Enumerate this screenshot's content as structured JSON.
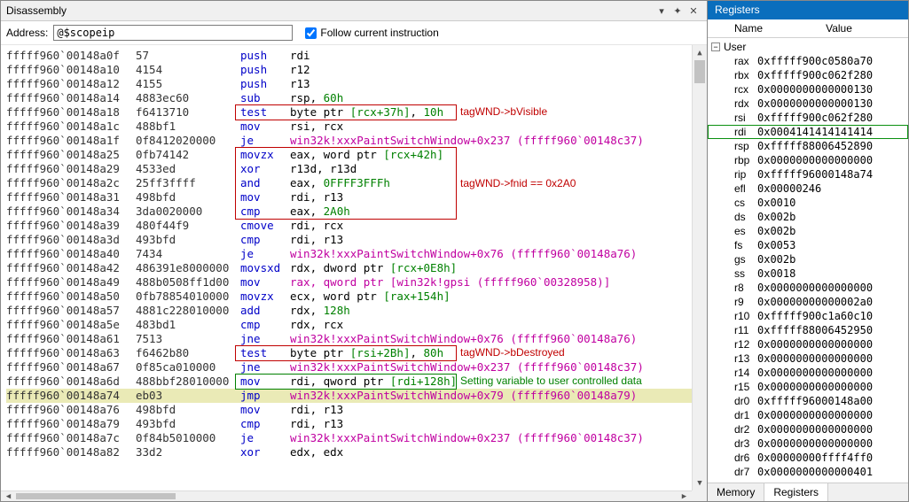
{
  "disasm": {
    "title": "Disassembly",
    "address_label": "Address:",
    "address_value": "@$scopeip",
    "follow_label": "Follow current instruction",
    "follow_checked": true,
    "rows": [
      {
        "addr": "fffff960`00148a0f",
        "bytes": "57",
        "mnem": "push",
        "ops": "rdi"
      },
      {
        "addr": "fffff960`00148a10",
        "bytes": "4154",
        "mnem": "push",
        "ops": "r12"
      },
      {
        "addr": "fffff960`00148a12",
        "bytes": "4155",
        "mnem": "push",
        "ops": "r13"
      },
      {
        "addr": "fffff960`00148a14",
        "bytes": "4883ec60",
        "mnem": "sub",
        "ops": "rsp, <num>60h</num>"
      },
      {
        "addr": "fffff960`00148a18",
        "bytes": "f6413710",
        "mnem": "test",
        "ops": "byte ptr <exp>[rcx+37h]</exp>, <num>10h</num>"
      },
      {
        "addr": "fffff960`00148a1c",
        "bytes": "488bf1",
        "mnem": "mov",
        "ops": "rsi, rcx"
      },
      {
        "addr": "fffff960`00148a1f",
        "bytes": "0f8412020000",
        "mnem": "je",
        "ops": "win32k!xxxPaintSwitchWindow+0x237 (fffff960`00148c37)",
        "call": true
      },
      {
        "addr": "fffff960`00148a25",
        "bytes": "0fb74142",
        "mnem": "movzx",
        "ops": "eax, word ptr <exp>[rcx+42h]</exp>"
      },
      {
        "addr": "fffff960`00148a29",
        "bytes": "4533ed",
        "mnem": "xor",
        "ops": "r13d, r13d"
      },
      {
        "addr": "fffff960`00148a2c",
        "bytes": "25ff3ffff",
        "mnem": "and",
        "ops": "eax, <num>0FFFF3FFFh</num>"
      },
      {
        "addr": "fffff960`00148a31",
        "bytes": "498bfd",
        "mnem": "mov",
        "ops": "rdi, r13"
      },
      {
        "addr": "fffff960`00148a34",
        "bytes": "3da0020000",
        "mnem": "cmp",
        "ops": "eax, <num>2A0h</num>"
      },
      {
        "addr": "fffff960`00148a39",
        "bytes": "480f44f9",
        "mnem": "cmove",
        "ops": "rdi, rcx"
      },
      {
        "addr": "fffff960`00148a3d",
        "bytes": "493bfd",
        "mnem": "cmp",
        "ops": "rdi, r13"
      },
      {
        "addr": "fffff960`00148a40",
        "bytes": "7434",
        "mnem": "je",
        "ops": "win32k!xxxPaintSwitchWindow+0x76 (fffff960`00148a76)",
        "call": true
      },
      {
        "addr": "fffff960`00148a42",
        "bytes": "486391e8000000",
        "mnem": "movsxd",
        "ops": "rdx, dword ptr <exp>[rcx+0E8h]</exp>"
      },
      {
        "addr": "fffff960`00148a49",
        "bytes": "488b0508ff1d00",
        "mnem": "mov",
        "ops": "rax, qword ptr [win32k!gpsi (fffff960`00328958)]",
        "call": true
      },
      {
        "addr": "fffff960`00148a50",
        "bytes": "0fb78854010000",
        "mnem": "movzx",
        "ops": "ecx, word ptr <exp>[rax+154h]</exp>"
      },
      {
        "addr": "fffff960`00148a57",
        "bytes": "4881c228010000",
        "mnem": "add",
        "ops": "rdx, <num>128h</num>"
      },
      {
        "addr": "fffff960`00148a5e",
        "bytes": "483bd1",
        "mnem": "cmp",
        "ops": "rdx, rcx"
      },
      {
        "addr": "fffff960`00148a61",
        "bytes": "7513",
        "mnem": "jne",
        "ops": "win32k!xxxPaintSwitchWindow+0x76 (fffff960`00148a76)",
        "call": true
      },
      {
        "addr": "fffff960`00148a63",
        "bytes": "f6462b80",
        "mnem": "test",
        "ops": "byte ptr <exp>[rsi+2Bh]</exp>, <num>80h</num>"
      },
      {
        "addr": "fffff960`00148a67",
        "bytes": "0f85ca010000",
        "mnem": "jne",
        "ops": "win32k!xxxPaintSwitchWindow+0x237 (fffff960`00148c37)",
        "call": true
      },
      {
        "addr": "fffff960`00148a6d",
        "bytes": "488bbf28010000",
        "mnem": "mov",
        "ops": "rdi, qword ptr <exp>[rdi+128h]</exp>"
      },
      {
        "addr": "fffff960`00148a74",
        "bytes": "eb03",
        "mnem": "jmp",
        "ops": "win32k!xxxPaintSwitchWindow+0x79 (fffff960`00148a79)",
        "call": true,
        "current": true
      },
      {
        "addr": "fffff960`00148a76",
        "bytes": "498bfd",
        "mnem": "mov",
        "ops": "rdi, r13"
      },
      {
        "addr": "fffff960`00148a79",
        "bytes": "493bfd",
        "mnem": "cmp",
        "ops": "rdi, r13"
      },
      {
        "addr": "fffff960`00148a7c",
        "bytes": "0f84b5010000",
        "mnem": "je",
        "ops": "win32k!xxxPaintSwitchWindow+0x237 (fffff960`00148c37)",
        "call": true
      },
      {
        "addr": "fffff960`00148a82",
        "bytes": "33d2",
        "mnem": "xor",
        "ops": "edx, edx"
      }
    ],
    "annotations": {
      "box1": {
        "top_row": 4,
        "rows": 1,
        "text": "tagWND->bVisible"
      },
      "box2": {
        "top_row": 7,
        "rows": 5,
        "text": "tagWND->fnid == 0x2A0"
      },
      "box3": {
        "top_row": 21,
        "rows": 1,
        "text": "tagWND->bDestroyed"
      },
      "gbox": {
        "top_row": 23,
        "rows": 1,
        "text": "Setting variable to user controlled data"
      }
    }
  },
  "registers": {
    "title": "Registers",
    "name_header": "Name",
    "value_header": "Value",
    "group": "User",
    "highlight": "rdi",
    "rows": [
      {
        "name": "rax",
        "val": "0xfffff900c0580a70"
      },
      {
        "name": "rbx",
        "val": "0xfffff900c062f280"
      },
      {
        "name": "rcx",
        "val": "0x0000000000000130"
      },
      {
        "name": "rdx",
        "val": "0x0000000000000130"
      },
      {
        "name": "rsi",
        "val": "0xfffff900c062f280"
      },
      {
        "name": "rdi",
        "val": "0x0004141414141414"
      },
      {
        "name": "rsp",
        "val": "0xfffff88006452890"
      },
      {
        "name": "rbp",
        "val": "0x0000000000000000"
      },
      {
        "name": "rip",
        "val": "0xfffff96000148a74"
      },
      {
        "name": "efl",
        "val": "0x00000246"
      },
      {
        "name": "cs",
        "val": "0x0010"
      },
      {
        "name": "ds",
        "val": "0x002b"
      },
      {
        "name": "es",
        "val": "0x002b"
      },
      {
        "name": "fs",
        "val": "0x0053"
      },
      {
        "name": "gs",
        "val": "0x002b"
      },
      {
        "name": "ss",
        "val": "0x0018"
      },
      {
        "name": "r8",
        "val": "0x0000000000000000"
      },
      {
        "name": "r9",
        "val": "0x00000000000002a0"
      },
      {
        "name": "r10",
        "val": "0xfffff900c1a60c10"
      },
      {
        "name": "r11",
        "val": "0xfffff88006452950"
      },
      {
        "name": "r12",
        "val": "0x0000000000000000"
      },
      {
        "name": "r13",
        "val": "0x0000000000000000"
      },
      {
        "name": "r14",
        "val": "0x0000000000000000"
      },
      {
        "name": "r15",
        "val": "0x0000000000000000"
      },
      {
        "name": "dr0",
        "val": "0xfffff96000148a00"
      },
      {
        "name": "dr1",
        "val": "0x0000000000000000"
      },
      {
        "name": "dr2",
        "val": "0x0000000000000000"
      },
      {
        "name": "dr3",
        "val": "0x0000000000000000"
      },
      {
        "name": "dr6",
        "val": "0x00000000ffff4ff0"
      },
      {
        "name": "dr7",
        "val": "0x0000000000000401"
      }
    ],
    "tabs": {
      "memory": "Memory",
      "registers": "Registers"
    }
  }
}
